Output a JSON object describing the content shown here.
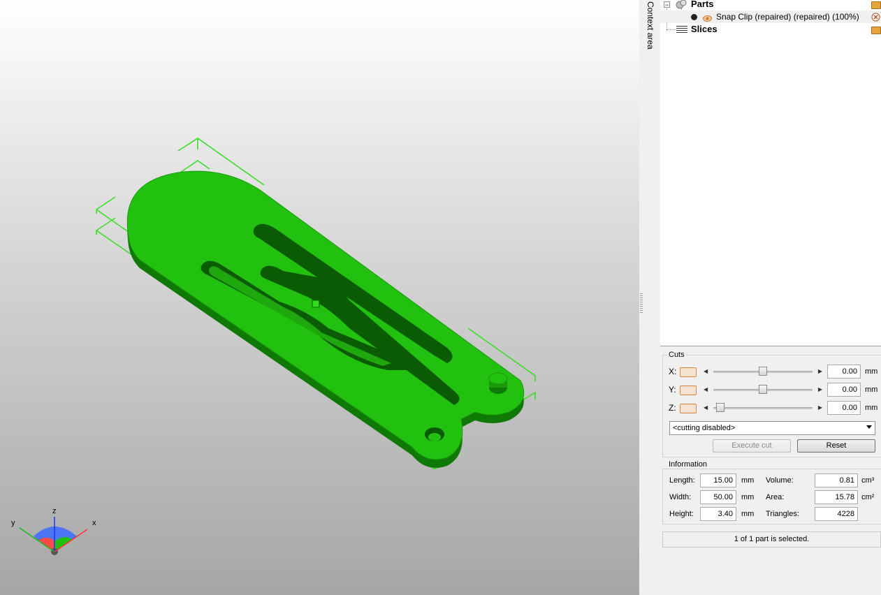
{
  "context_area_label": "Context area",
  "tree": {
    "parts_label": "Parts",
    "part_item_label": "Snap Clip (repaired) (repaired) (100%)",
    "slices_label": "Slices",
    "expander_symbol": "−"
  },
  "cuts": {
    "title": "Cuts",
    "x_label": "X:",
    "y_label": "Y:",
    "z_label": "Z:",
    "x_value": "0.00",
    "y_value": "0.00",
    "z_value": "0.00",
    "unit": "mm",
    "mode_selected": "<cutting disabled>",
    "execute_label": "Execute cut",
    "reset_label": "Reset"
  },
  "information": {
    "title": "Information",
    "length_label": "Length:",
    "length_value": "15.00",
    "width_label": "Width:",
    "width_value": "50.00",
    "height_label": "Height:",
    "height_value": "3.40",
    "dim_unit": "mm",
    "volume_label": "Volume:",
    "volume_value": "0.81",
    "volume_unit": "cm³",
    "area_label": "Area:",
    "area_value": "15.78",
    "area_unit": "cm²",
    "triangles_label": "Triangles:",
    "triangles_value": "4228"
  },
  "status_text": "1 of 1 part is selected.",
  "axes": {
    "x": "x",
    "y": "y",
    "z": "z"
  },
  "colors": {
    "model_green": "#22c10f",
    "model_dark": "#0e7a05",
    "bbox_green": "#3ddc2a",
    "accent_orange": "#e0843a"
  }
}
